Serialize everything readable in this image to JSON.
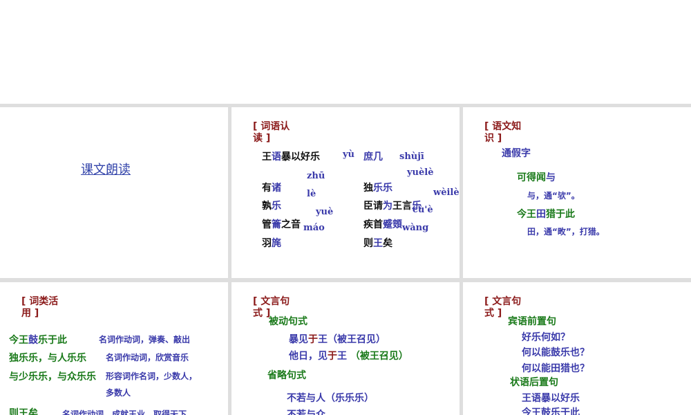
{
  "colors": {
    "r": "#8b1a1a",
    "b": "#3a3aaa",
    "g": "#1a7a1a",
    "k": "#111111"
  },
  "p0": {
    "link": "课文朗读"
  },
  "p1": {
    "title": "[ 词语认读 ]",
    "lines": [
      [
        {
          "t": "王",
          "c": "k"
        },
        {
          "t": "语",
          "c": "b"
        },
        {
          "t": "暴以好乐",
          "c": "k"
        }
      ],
      [
        {
          "t": "有",
          "c": "k"
        },
        {
          "t": "诸",
          "c": "b"
        }
      ],
      [
        {
          "t": "孰",
          "c": "k"
        },
        {
          "t": "乐",
          "c": "b"
        }
      ],
      [
        {
          "t": "管",
          "c": "k"
        },
        {
          "t": "籥",
          "c": "b"
        },
        {
          "t": "之音",
          "c": "k"
        }
      ],
      [
        {
          "t": "羽",
          "c": "k"
        },
        {
          "t": "旄",
          "c": "b"
        }
      ],
      [
        {
          "t": "庶几",
          "c": "b"
        }
      ],
      [
        {
          "t": "独",
          "c": "k"
        },
        {
          "t": "乐乐",
          "c": "b"
        }
      ],
      [
        {
          "t": "臣请",
          "c": "k"
        },
        {
          "t": "为",
          "c": "b"
        },
        {
          "t": "王言",
          "c": "k"
        },
        {
          "t": "乐",
          "c": "b"
        }
      ],
      [
        {
          "t": "疾首",
          "c": "k"
        },
        {
          "t": "蹙頞",
          "c": "b"
        }
      ],
      [
        {
          "t": "则",
          "c": "k"
        },
        {
          "t": "王",
          "c": "b"
        },
        {
          "t": "矣",
          "c": "k"
        }
      ]
    ],
    "pinyin": [
      "yù",
      "shùjī",
      "yuèlè",
      "zhū",
      "lè",
      "wèilè",
      "yuè",
      "cù'è",
      "máo",
      "wàng"
    ]
  },
  "p2": {
    "title": "[ 语文知识 ]",
    "lines": [
      [
        {
          "t": "通假字",
          "c": "b"
        }
      ],
      [
        {
          "t": "可得闻",
          "c": "g"
        },
        {
          "t": "与",
          "c": "b"
        }
      ],
      [
        {
          "t": "与，通“欤”。",
          "c": "b"
        }
      ],
      [
        {
          "t": "今王",
          "c": "g"
        },
        {
          "t": "田",
          "c": "b"
        },
        {
          "t": "猎于此",
          "c": "g"
        }
      ],
      [
        {
          "t": "田，通“畋”，打猎。",
          "c": "b"
        }
      ]
    ]
  },
  "p3": {
    "title": "[ 词类活用 ]",
    "lines": [
      [
        {
          "t": "今王",
          "c": "g"
        },
        {
          "t": "鼓",
          "c": "b"
        },
        {
          "t": "乐于此",
          "c": "g"
        }
      ],
      [
        {
          "t": "名词作动词，弹奏、敲出",
          "c": "b"
        }
      ],
      [
        {
          "t": "独乐乐，与人乐乐",
          "c": "g"
        }
      ],
      [
        {
          "t": "名词作动词，欣赏音乐",
          "c": "b"
        }
      ],
      [
        {
          "t": "与少乐乐，与众乐乐",
          "c": "g"
        }
      ],
      [
        {
          "t": "形容词作名词，少数人，",
          "c": "b"
        }
      ],
      [
        {
          "t": "多数人",
          "c": "b"
        }
      ],
      [
        {
          "t": "则王矣",
          "c": "g"
        }
      ],
      [
        {
          "t": "名词作动词，成就王业，取得天下",
          "c": "b"
        }
      ]
    ]
  },
  "p4": {
    "title": "[ 文言句式 ]",
    "lines": [
      [
        {
          "t": "被动句式",
          "c": "g"
        }
      ],
      [
        {
          "t": "暴见",
          "c": "b"
        },
        {
          "t": "于",
          "c": "r"
        },
        {
          "t": "王（被王召见）",
          "c": "b"
        }
      ],
      [
        {
          "t": "他日，见",
          "c": "b"
        },
        {
          "t": "于",
          "c": "r"
        },
        {
          "t": "王 ",
          "c": "b"
        },
        {
          "t": "（被王召见）",
          "c": "g"
        }
      ],
      [
        {
          "t": "省略句式",
          "c": "g"
        }
      ],
      [
        {
          "t": "不若与人（乐乐乐）",
          "c": "b"
        }
      ],
      [
        {
          "t": "不若与众",
          "c": "b"
        }
      ]
    ]
  },
  "p5": {
    "title": "[ 文言句式 ]",
    "lines": [
      [
        {
          "t": "宾语前置句",
          "c": "g"
        }
      ],
      [
        {
          "t": "好乐何如？",
          "c": "b"
        }
      ],
      [
        {
          "t": "何以能鼓乐也？",
          "c": "b"
        }
      ],
      [
        {
          "t": "何以能田猎也？",
          "c": "b"
        }
      ],
      [
        {
          "t": "状语后置句",
          "c": "g"
        }
      ],
      [
        {
          "t": "王语暴以好乐",
          "c": "b"
        }
      ],
      [
        {
          "t": "今王鼓乐于此",
          "c": "b"
        }
      ]
    ]
  }
}
